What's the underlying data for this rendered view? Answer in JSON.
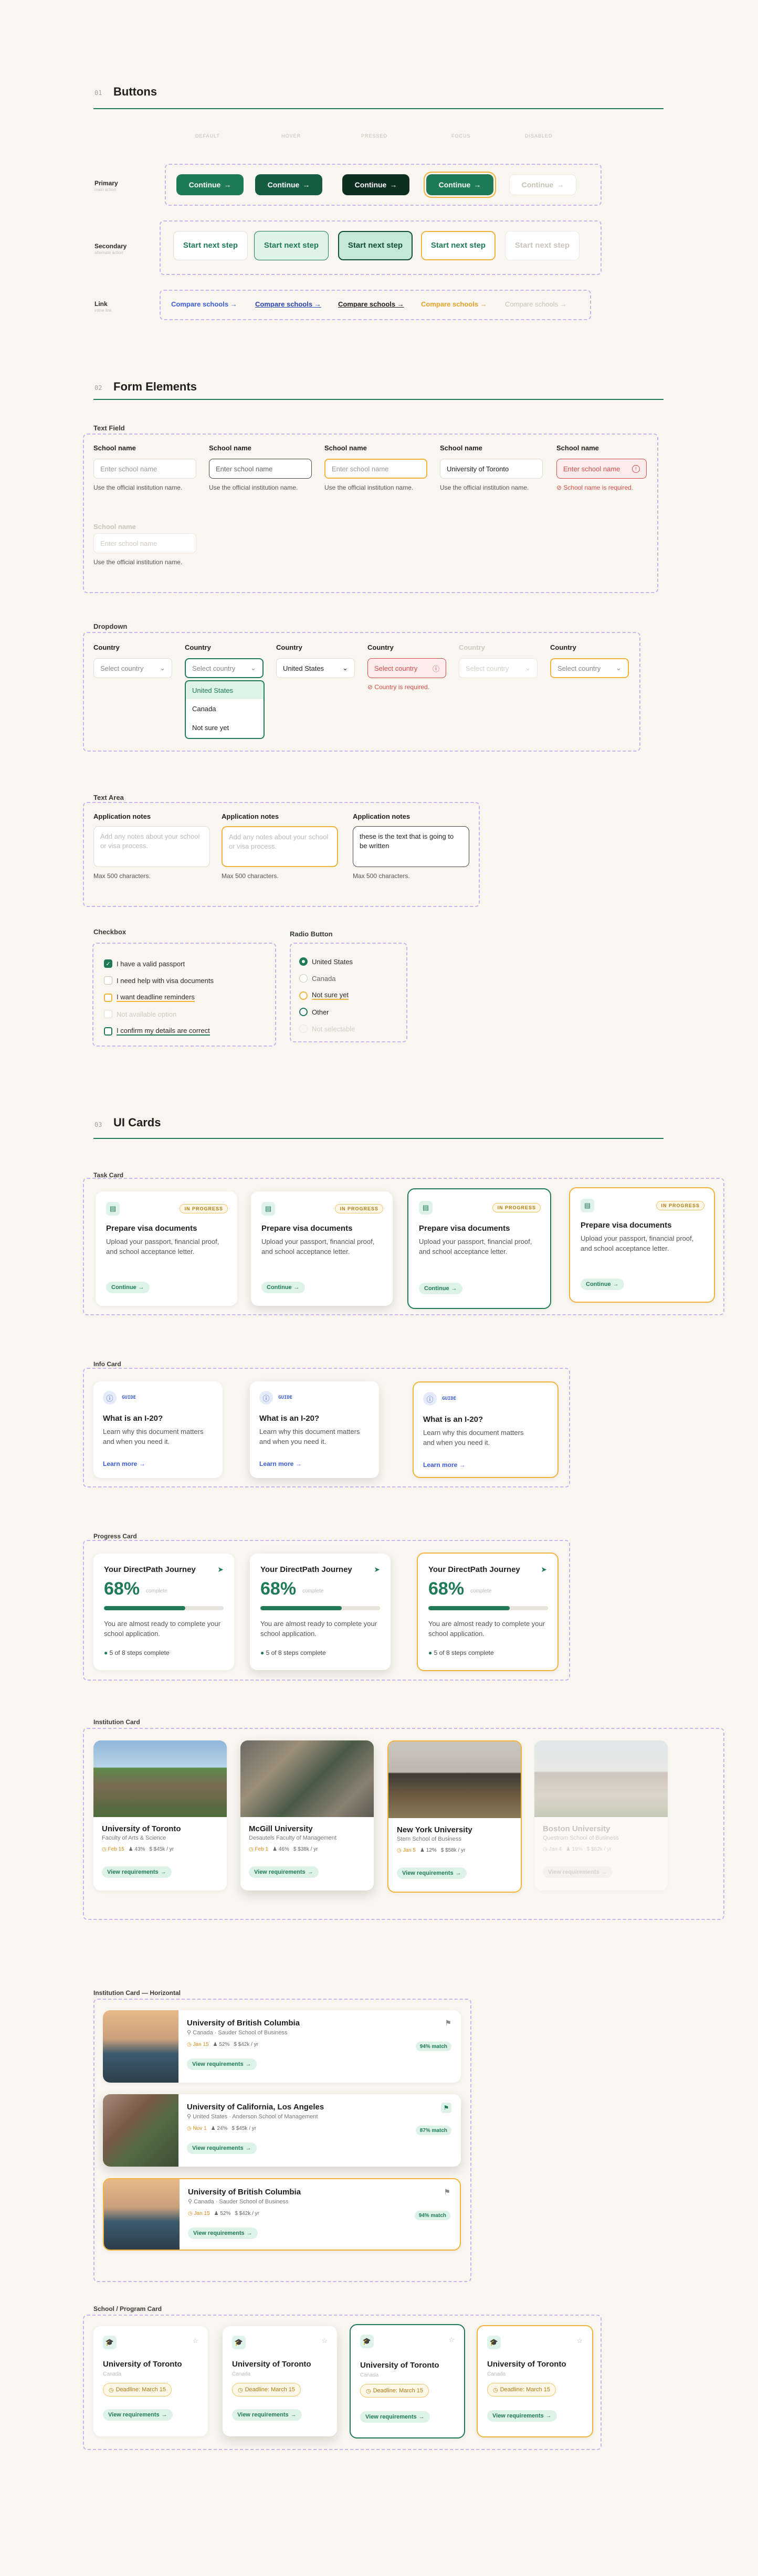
{
  "sections": {
    "buttons": {
      "num": "01",
      "title": "Buttons"
    },
    "forms": {
      "num": "02",
      "title": "Form Elements"
    },
    "cards": {
      "num": "03",
      "title": "UI Cards"
    }
  },
  "button_states": [
    "DEFAULT",
    "HOVER",
    "PRESSED",
    "FOCUS",
    "DISABLED"
  ],
  "button_rows": {
    "primary": {
      "label": "Primary",
      "sub": "main action",
      "text": "Continue"
    },
    "secondary": {
      "label": "Secondary",
      "sub": "alternate action",
      "text": "Start next step"
    },
    "link": {
      "label": "Link",
      "sub": "inline link",
      "text": "Compare schools"
    }
  },
  "text_field": {
    "group": "Text Field",
    "label": "School name",
    "placeholder": "Enter school name",
    "filled": "University of Toronto",
    "help": "Use the official institution name.",
    "error": "School name is required."
  },
  "dropdown": {
    "group": "Dropdown",
    "label": "Country",
    "placeholder": "Select country",
    "selected": "United States",
    "options": [
      "United States",
      "Canada",
      "Not sure yet"
    ],
    "error": "Country is required."
  },
  "text_area": {
    "group": "Text Area",
    "label": "Application notes",
    "placeholder": "Add any notes about your school or visa process.",
    "filled": "these is the text that is going to be written",
    "help": "Max 500 characters."
  },
  "checkbox": {
    "group": "Checkbox",
    "items": [
      "I have a valid passport",
      "I need help with visa documents",
      "I want deadline reminders",
      "Not available option",
      "I confirm my details are correct"
    ]
  },
  "radio": {
    "group": "Radio Button",
    "items": [
      "United States",
      "Canada",
      "Not sure yet",
      "Other",
      "Not selectable"
    ]
  },
  "task_card": {
    "group": "Task Card",
    "badge": "IN PROGRESS",
    "title": "Prepare visa documents",
    "desc": "Upload your passport, financial proof, and school acceptance letter.",
    "action": "Continue"
  },
  "info_card": {
    "group": "Info Card",
    "code": "GUIDE",
    "title": "What is an I-20?",
    "desc": "Learn why this document matters and when you need it.",
    "action": "Learn more"
  },
  "progress_card": {
    "group": "Progress Card",
    "title": "Your DirectPath Journey",
    "percent": "68%",
    "percent_value": 0.68,
    "percent_caption": "complete",
    "desc": "You are almost ready to complete your school application.",
    "steps": "5 of 8 steps complete"
  },
  "institution_cards": {
    "group": "Institution Card",
    "action": "View requirements",
    "items": [
      {
        "name": "University of Toronto",
        "faculty": "Faculty of Arts & Science",
        "deadline": "Feb 15",
        "rate": "43%",
        "tuition": "$45k / yr"
      },
      {
        "name": "McGill University",
        "faculty": "Desautels Faculty of Management",
        "deadline": "Feb 1",
        "rate": "46%",
        "tuition": "$38k / yr"
      },
      {
        "name": "New York University",
        "faculty": "Stern School of Business",
        "deadline": "Jan 5",
        "rate": "12%",
        "tuition": "$58k / yr"
      },
      {
        "name": "Boston University",
        "faculty": "Questrom School of Business",
        "deadline": "Jan 4",
        "rate": "19%",
        "tuition": "$62k / yr"
      }
    ]
  },
  "horizontal_cards": {
    "group": "Institution Card — Horizontal",
    "action": "View requirements",
    "items": [
      {
        "name": "University of British Columbia",
        "loc": "Canada · Sauder School of Business",
        "deadline": "Jan 15",
        "rate": "52%",
        "tuition": "$42k / yr",
        "match": "94% match"
      },
      {
        "name": "University of California, Los Angeles",
        "loc": "United States · Anderson School of Management",
        "deadline": "Nov 1",
        "rate": "24%",
        "tuition": "$45k / yr",
        "match": "87% match"
      },
      {
        "name": "University of British Columbia",
        "loc": "Canada · Sauder School of Business",
        "deadline": "Jan 15",
        "rate": "52%",
        "tuition": "$42k / yr",
        "match": "94% match"
      }
    ]
  },
  "program_card": {
    "group": "School / Program Card",
    "name": "University of Toronto",
    "country": "Canada",
    "deadline": "Deadline: March 15",
    "action": "View requirements"
  },
  "colors": {
    "brand": "#1f7a58",
    "accent": "#f1b33c",
    "link": "#3b5bd9",
    "error": "#d64a4a",
    "dashed": "#c9b3ec"
  },
  "icons": [
    "arrow-right-icon",
    "chevron-down-icon",
    "check-icon",
    "error-icon",
    "document-icon",
    "info-icon",
    "send-icon",
    "bookmark-icon",
    "location-icon",
    "calendar-icon",
    "users-icon",
    "money-icon",
    "cap-icon"
  ]
}
